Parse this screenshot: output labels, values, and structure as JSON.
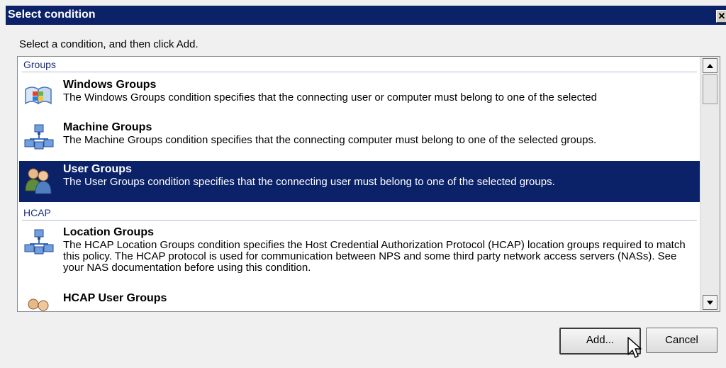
{
  "dialog": {
    "title": "Select condition",
    "close_glyph": "✕",
    "instruction": "Select a condition, and then click Add."
  },
  "list": {
    "groups": [
      {
        "header": "Groups",
        "items": [
          {
            "name": "Windows Groups",
            "description": "The Windows Groups condition specifies that the connecting user or computer must belong to one of the selected",
            "icon": "windows-groups-icon",
            "selected": false
          },
          {
            "name": "Machine Groups",
            "description": "The Machine Groups condition specifies that the connecting computer must belong to one of the selected groups.",
            "icon": "machine-groups-icon",
            "selected": false
          },
          {
            "name": "User Groups",
            "description": "The User Groups condition specifies that the connecting user must belong to one of the selected groups.",
            "icon": "user-groups-icon",
            "selected": true
          }
        ]
      },
      {
        "header": "HCAP",
        "items": [
          {
            "name": "Location Groups",
            "description": "The HCAP Location Groups condition specifies the Host Credential Authorization Protocol (HCAP) location groups required to match this policy. The HCAP protocol is used for communication between NPS and some third party network access servers (NASs). See your NAS documentation before using this condition.",
            "icon": "location-groups-icon",
            "selected": false
          },
          {
            "name": "HCAP User Groups",
            "description": "",
            "icon": "hcap-user-groups-icon",
            "selected": false
          }
        ]
      }
    ]
  },
  "buttons": {
    "add": "Add...",
    "cancel": "Cancel"
  },
  "colors": {
    "title_bar": "#0b2168",
    "selection": "#0b2168",
    "group_header_text": "#1a2f7c"
  }
}
